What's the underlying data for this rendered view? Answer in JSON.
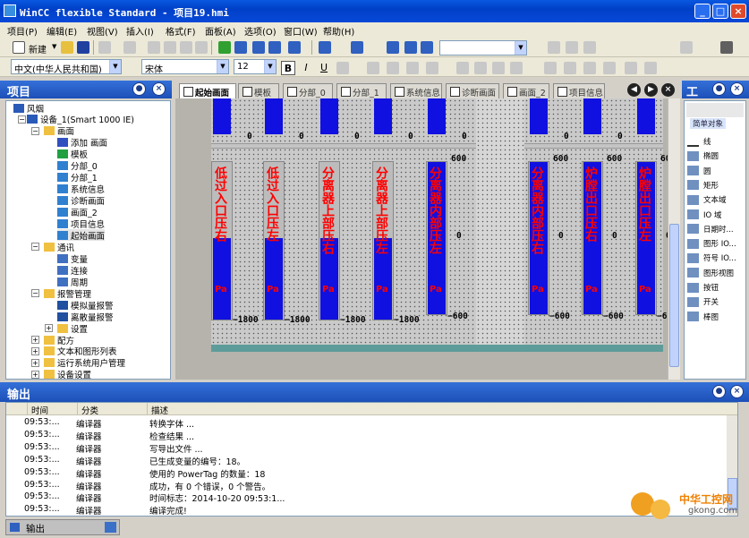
{
  "title": "WinCC flexible Standard - 项目19.hmi",
  "window_buttons": {
    "min": "_",
    "max": "□",
    "close": "×"
  },
  "menus": [
    "项目(P)",
    "编辑(E)",
    "视图(V)",
    "插入(I)",
    "格式(F)",
    "面板(A)",
    "选项(O)",
    "窗口(W)",
    "帮助(H)"
  ],
  "toolbar": {
    "new_label": "新建",
    "new_arrow": "▼",
    "dropdown_arrow": "▼"
  },
  "format_bar": {
    "language": "中文(中华人民共和国)",
    "font": "宋体",
    "size": "12",
    "bold": "B",
    "italic": "I",
    "underline": "U"
  },
  "project_panel": {
    "title": "项目",
    "pin": "●",
    "close": "×",
    "tree": [
      {
        "label": "风烟",
        "depth": 0,
        "icon": "project-icon"
      },
      {
        "label": "设备_1(Smart 1000 IE)",
        "depth": 1,
        "icon": "device-icon",
        "exp": "−"
      },
      {
        "label": "画面",
        "depth": 2,
        "icon": "folder-icon",
        "exp": "−"
      },
      {
        "label": "添加 画面",
        "depth": 3,
        "icon": "add-screen-icon"
      },
      {
        "label": "模板",
        "depth": 3,
        "icon": "template-icon"
      },
      {
        "label": "分部_0",
        "depth": 3,
        "icon": "screen-icon"
      },
      {
        "label": "分部_1",
        "depth": 3,
        "icon": "screen-icon"
      },
      {
        "label": "系统信息",
        "depth": 3,
        "icon": "screen-icon"
      },
      {
        "label": "诊断画面",
        "depth": 3,
        "icon": "screen-icon"
      },
      {
        "label": "画面_2",
        "depth": 3,
        "icon": "screen-icon"
      },
      {
        "label": "项目信息",
        "depth": 3,
        "icon": "screen-icon"
      },
      {
        "label": "起始画面",
        "depth": 3,
        "icon": "screen-icon",
        "selected": true
      },
      {
        "label": "通讯",
        "depth": 2,
        "icon": "folder-icon",
        "exp": "−"
      },
      {
        "label": "变量",
        "depth": 3,
        "icon": "tags-icon"
      },
      {
        "label": "连接",
        "depth": 3,
        "icon": "connection-icon"
      },
      {
        "label": "周期",
        "depth": 3,
        "icon": "cycle-icon"
      },
      {
        "label": "报警管理",
        "depth": 2,
        "icon": "folder-icon",
        "exp": "−"
      },
      {
        "label": "模拟量报警",
        "depth": 3,
        "icon": "alarm-icon"
      },
      {
        "label": "离散量报警",
        "depth": 3,
        "icon": "alarm-icon"
      },
      {
        "label": "设置",
        "depth": 3,
        "icon": "folder-icon",
        "exp": "+"
      },
      {
        "label": "配方",
        "depth": 2,
        "icon": "folder-icon",
        "exp": "+"
      },
      {
        "label": "文本和图形列表",
        "depth": 2,
        "icon": "folder-icon",
        "exp": "+"
      },
      {
        "label": "运行系统用户管理",
        "depth": 2,
        "icon": "folder-icon",
        "exp": "+"
      },
      {
        "label": "设备设置",
        "depth": 2,
        "icon": "folder-icon",
        "exp": "+"
      }
    ]
  },
  "editor_tabs": [
    "起始画面",
    "模板",
    "分部_0",
    "分部_1",
    "系统信息",
    "诊断画面",
    "画面_2",
    "项目信息"
  ],
  "tab_nav": {
    "prev": "◀",
    "next": "▶",
    "close": "×"
  },
  "screen": {
    "top_values": [
      "0",
      "0",
      "0",
      "0",
      "0",
      "0",
      "0",
      "0"
    ],
    "gauges": [
      {
        "label": "低过入口压右",
        "unit": "Pa",
        "max": "",
        "min": "−1800",
        "hatch": true
      },
      {
        "label": "低过入口压左",
        "unit": "Pa",
        "max": "",
        "min": "−1800"
      },
      {
        "label": "分离器上部压右",
        "unit": "Pa",
        "max": "",
        "min": "−1800"
      },
      {
        "label": "分离器上部压左",
        "unit": "Pa",
        "max": "",
        "min": "−1800"
      },
      {
        "label": "分离器内部压左",
        "unit": "Pa",
        "max": "600",
        "min": "−600",
        "mid": "0"
      },
      {
        "label": "分离器内部压右",
        "unit": "Pa",
        "max": "600",
        "min": "−600",
        "mid": "0"
      },
      {
        "label": "炉膛出口压右",
        "unit": "Pa",
        "max": "600",
        "min": "−600",
        "mid": "0"
      },
      {
        "label": "炉膛出口压左",
        "unit": "Pa",
        "max": "600",
        "min": "−600",
        "mid": "0"
      }
    ]
  },
  "tools_panel": {
    "title": "工",
    "pin": "●",
    "close": "×",
    "section": "简单对象",
    "items": [
      "线",
      "椭圆",
      "圆",
      "矩形",
      "文本域",
      "IO 域",
      "日期时...",
      "图形 IO...",
      "符号 IO...",
      "图形视图",
      "按钮",
      "开关",
      "棒图"
    ]
  },
  "output": {
    "title": "输出",
    "pin": "●",
    "close": "×",
    "columns": [
      "时间",
      "分类",
      "描述"
    ],
    "rows": [
      [
        "09:53:...",
        "编译器",
        "转换字体 ..."
      ],
      [
        "09:53:...",
        "编译器",
        "检查结果 ..."
      ],
      [
        "09:53:...",
        "编译器",
        "写导出文件 ..."
      ],
      [
        "09:53:...",
        "编译器",
        "已生成变量的编号：18。"
      ],
      [
        "09:53:...",
        "编译器",
        "使用的 PowerTag 的数量：18"
      ],
      [
        "09:53:...",
        "编译器",
        "成功，有 0 个错误，0 个警告。"
      ],
      [
        "09:53:...",
        "编译器",
        "时间标志：2014-10-20 09:53:1..."
      ],
      [
        "09:53:...",
        "编译器",
        "编译完成!"
      ]
    ]
  },
  "bottom_tab": "输出",
  "watermark": {
    "cn": "中华工控网",
    "url": "gkong.com"
  }
}
